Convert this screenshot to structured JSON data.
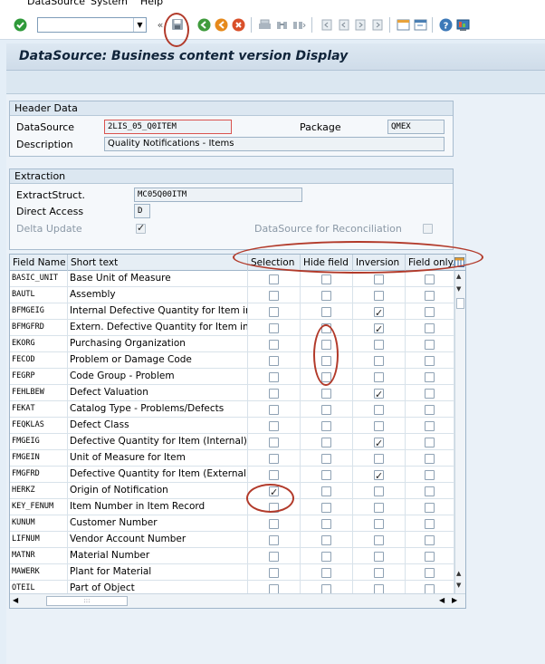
{
  "menu": {
    "items": [
      "DataSource",
      "System",
      "Help"
    ]
  },
  "window": {
    "title": "DataSource: Business content version Display"
  },
  "header_data": {
    "title": "Header Data",
    "datasource_label": "DataSource",
    "datasource_value": "2LIS_05_Q0ITEM",
    "package_label": "Package",
    "package_value": "QMEX",
    "description_label": "Description",
    "description_value": "Quality Notifications - Items"
  },
  "extraction": {
    "title": "Extraction",
    "extract_struct_label": "ExtractStruct.",
    "extract_struct_value": "MC05Q00ITM",
    "direct_access_label": "Direct Access",
    "direct_access_value": "D",
    "delta_update_label": "Delta Update",
    "delta_update_checked": true,
    "reconciliation_label": "DataSource for Reconciliation",
    "reconciliation_checked": false
  },
  "grid": {
    "columns": [
      "Field Name",
      "Short text",
      "Selection",
      "Hide field",
      "Inversion",
      "Field only..."
    ],
    "rows": [
      {
        "field": "BASIC_UNIT",
        "text": "Base Unit of Measure",
        "sel": false,
        "hide": false,
        "inv": false,
        "only": false
      },
      {
        "field": "BAUTL",
        "text": "Assembly",
        "sel": false,
        "hide": false,
        "inv": false,
        "only": false
      },
      {
        "field": "BFMGEIG",
        "text": "Internal Defective Quantity for Item in B...",
        "sel": false,
        "hide": false,
        "inv": true,
        "only": false
      },
      {
        "field": "BFMGFRD",
        "text": "Extern. Defective Quantity for Item in B...",
        "sel": false,
        "hide": false,
        "inv": true,
        "only": false
      },
      {
        "field": "EKORG",
        "text": "Purchasing Organization",
        "sel": false,
        "hide": false,
        "inv": false,
        "only": false
      },
      {
        "field": "FECOD",
        "text": "Problem or Damage Code",
        "sel": false,
        "hide": false,
        "inv": false,
        "only": false
      },
      {
        "field": "FEGRP",
        "text": "Code Group - Problem",
        "sel": false,
        "hide": false,
        "inv": false,
        "only": false
      },
      {
        "field": "FEHLBEW",
        "text": "Defect Valuation",
        "sel": false,
        "hide": false,
        "inv": true,
        "only": false
      },
      {
        "field": "FEKAT",
        "text": "Catalog Type - Problems/Defects",
        "sel": false,
        "hide": false,
        "inv": false,
        "only": false
      },
      {
        "field": "FEQKLAS",
        "text": "Defect Class",
        "sel": false,
        "hide": false,
        "inv": false,
        "only": false
      },
      {
        "field": "FMGEIG",
        "text": "Defective Quantity for Item (Internal)",
        "sel": false,
        "hide": false,
        "inv": true,
        "only": false
      },
      {
        "field": "FMGEIN",
        "text": "Unit of Measure for Item",
        "sel": false,
        "hide": false,
        "inv": false,
        "only": false
      },
      {
        "field": "FMGFRD",
        "text": "Defective Quantity for Item (External)",
        "sel": false,
        "hide": false,
        "inv": true,
        "only": false
      },
      {
        "field": "HERKZ",
        "text": "Origin of Notification",
        "sel": true,
        "hide": false,
        "inv": false,
        "only": false
      },
      {
        "field": "KEY_FENUM",
        "text": "Item Number in Item Record",
        "sel": false,
        "hide": false,
        "inv": false,
        "only": false
      },
      {
        "field": "KUNUM",
        "text": "Customer Number",
        "sel": false,
        "hide": false,
        "inv": false,
        "only": false
      },
      {
        "field": "LIFNUM",
        "text": "Vendor Account Number",
        "sel": false,
        "hide": false,
        "inv": false,
        "only": false
      },
      {
        "field": "MATNR",
        "text": "Material Number",
        "sel": false,
        "hide": false,
        "inv": false,
        "only": false
      },
      {
        "field": "MAWERK",
        "text": "Plant for Material",
        "sel": false,
        "hide": false,
        "inv": false,
        "only": false
      },
      {
        "field": "OTEIL",
        "text": "Part of Object",
        "sel": false,
        "hide": false,
        "inv": false,
        "only": false
      }
    ],
    "hscroll_label": ":::"
  },
  "icons": [
    "enter-icon",
    "save-icon",
    "back-icon",
    "exit-icon",
    "cancel-icon",
    "print-icon",
    "find-icon",
    "find-next-icon",
    "first-page-icon",
    "prev-page-icon",
    "next-page-icon",
    "last-page-icon",
    "new-session-icon",
    "shortcut-icon",
    "help-icon",
    "customize-layout-icon"
  ],
  "colors": {
    "annotation": "#b23a2a",
    "title_text": "#10243a"
  }
}
